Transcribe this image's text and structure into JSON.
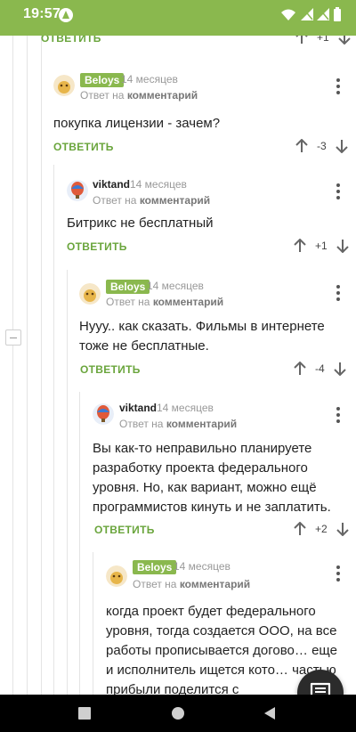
{
  "status_bar": {
    "time": "19:57"
  },
  "top_action": {
    "reply_label": "ОТВЕТИТЬ",
    "score": "+1"
  },
  "comments": [
    {
      "author": "Beloys",
      "author_style": "badge",
      "time": "14 месяцев",
      "reply_prefix": "Ответ на",
      "reply_target": "комментарий",
      "text": "покупка лицензии - зачем?",
      "reply_label": "ОТВЕТИТЬ",
      "score": "-3"
    },
    {
      "author": "viktand",
      "author_style": "plain",
      "time": "14 месяцев",
      "reply_prefix": "Ответ на",
      "reply_target": "комментарий",
      "text": "Битрикс не бесплатный",
      "reply_label": "ОТВЕТИТЬ",
      "score": "+1"
    },
    {
      "author": "Beloys",
      "author_style": "badge",
      "time": "14 месяцев",
      "reply_prefix": "Ответ на",
      "reply_target": "комментарий",
      "text": "Нууу.. как сказать. Фильмы в интернете тоже не бесплатные.",
      "reply_label": "ОТВЕТИТЬ",
      "score": "-4"
    },
    {
      "author": "viktand",
      "author_style": "plain",
      "time": "14 месяцев",
      "reply_prefix": "Ответ на",
      "reply_target": "комментарий",
      "text": "Вы как-то неправильно планируете разработку проекта федерального уровня. Но, как вариант, можно ещё программистов кинуть и не заплатить.",
      "reply_label": "ОТВЕТИТЬ",
      "score": "+2"
    },
    {
      "author": "Beloys",
      "author_style": "badge",
      "time": "14 месяцев",
      "reply_prefix": "Ответ на",
      "reply_target": "комментарий",
      "text": "когда проект будет федерального уровня, тогда создается ООО, на все работы прописывается догово… еще и исполнитель ищется кото… частью прибыли поделится с"
    }
  ],
  "icons": {
    "fab": "message-icon",
    "upvote": "arrow-up-icon",
    "downvote": "arrow-down-icon",
    "menu": "more-vertical-icon"
  },
  "colors": {
    "accent": "#8ab84e",
    "reply_link": "#6aa53c"
  }
}
